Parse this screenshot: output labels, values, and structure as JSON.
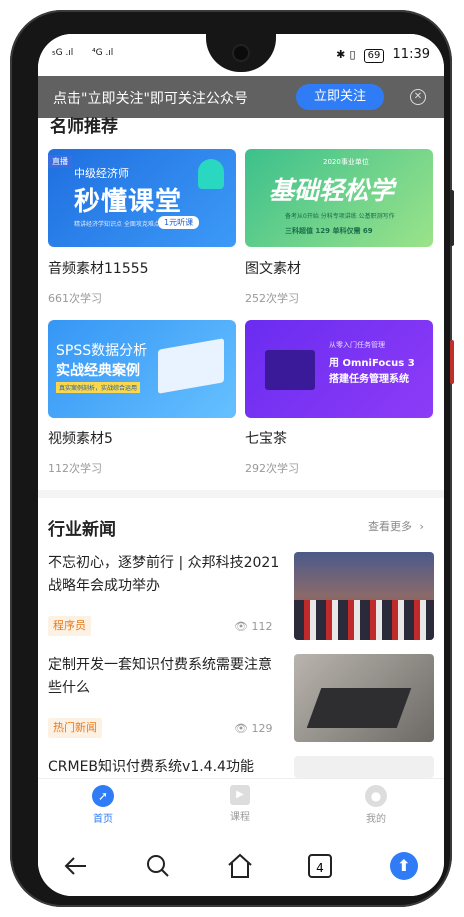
{
  "status_bar": {
    "signal_left": "₅G .ıl",
    "signal_right": "⁴G .ıl",
    "battery": "69",
    "time": "11:39"
  },
  "banner": {
    "text": "点击\"立即关注\"即可关注公众号",
    "follow_label": "立即关注"
  },
  "recommend": {
    "title": "名师推荐",
    "cards": [
      {
        "title": "音频素材11555",
        "meta": "661次学习",
        "img_tag": "直播",
        "img_line1": "中级经济师",
        "img_line2": "秒懂课堂",
        "img_line3": "精讲经济学知识点 全面攻克难点",
        "img_badge": "1元听课"
      },
      {
        "title": "图文素材",
        "meta": "252次学习",
        "img_line1": "2020事业单位",
        "img_line2": "基础轻松学",
        "img_line3": "备考从0开始 分科专项讲练 公基职测写作",
        "img_badge": "三科超值 129 单科仅需 69"
      },
      {
        "title": "视频素材5",
        "meta": "112次学习",
        "img_line1": "SPSS数据分析",
        "img_line2": "实战经典案例",
        "img_line3": "真实案例剖析，实战综合运用"
      },
      {
        "title": "七宝茶",
        "meta": "292次学习",
        "img_line1": "从零入门任务管理",
        "img_line2": "用 OmniFocus 3",
        "img_line3": "搭建任务管理系统"
      }
    ]
  },
  "news": {
    "title": "行业新闻",
    "more_label": "查看更多",
    "items": [
      {
        "title": "不忘初心，逐梦前行 | 众邦科技2021战略年会成功举办",
        "tag": "程序员",
        "views": "112"
      },
      {
        "title": "定制开发一套知识付费系统需要注意些什么",
        "tag": "热门新闻",
        "views": "129"
      },
      {
        "title": "CRMEB知识付费系统v1.4.4功能"
      }
    ]
  },
  "tabs": [
    {
      "label": "首页",
      "icon": "compass-icon",
      "active": true
    },
    {
      "label": "课程",
      "icon": "play-icon",
      "active": false
    },
    {
      "label": "我的",
      "icon": "user-icon",
      "active": false
    }
  ],
  "nav": {
    "tab_count": "4"
  },
  "colors": {
    "accent": "#2f7cf6",
    "banner": "#616161",
    "tag_text": "#e87a1a",
    "tag_bg": "#fdf1e4"
  }
}
